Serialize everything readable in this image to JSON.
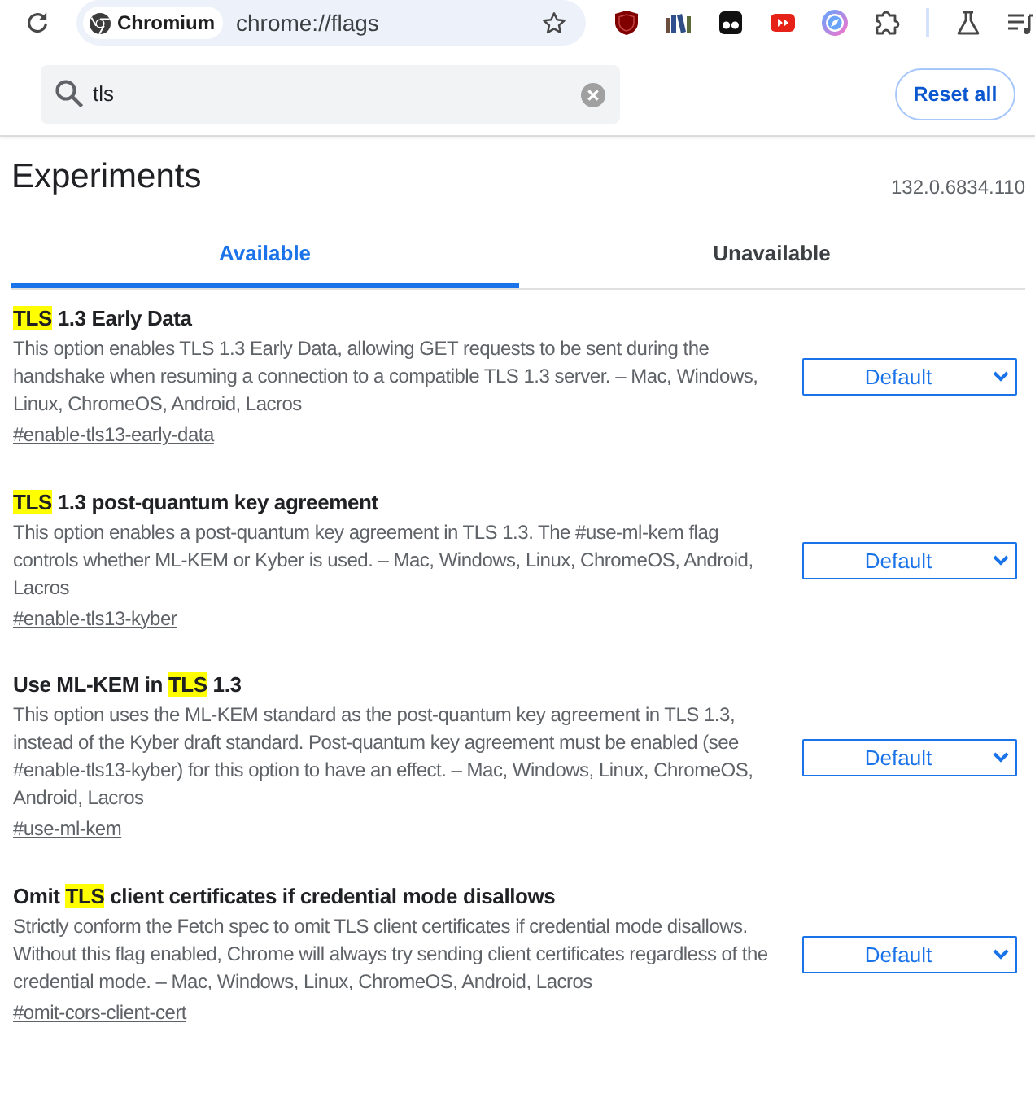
{
  "toolbar": {
    "site_chip": "Chromium",
    "url": "chrome://flags"
  },
  "search": {
    "value": "tls"
  },
  "reset_button": "Reset all",
  "header": {
    "title": "Experiments",
    "version": "132.0.6834.110"
  },
  "tabs": [
    {
      "label": "Available",
      "selected": true
    },
    {
      "label": "Unavailable",
      "selected": false
    }
  ],
  "flags": [
    {
      "title": [
        {
          "text": "TLS",
          "highlighted": true
        },
        {
          "text": " 1.3 Early Data",
          "highlighted": false
        }
      ],
      "description": "This option enables TLS 1.3 Early Data, allowing GET requests to be sent during the handshake when resuming a connection to a compatible TLS 1.3 server. – Mac, Windows, Linux, ChromeOS, Android, Lacros",
      "link": "#enable-tls13-early-data",
      "value": "Default"
    },
    {
      "title": [
        {
          "text": "TLS",
          "highlighted": true
        },
        {
          "text": " 1.3 post-quantum key agreement",
          "highlighted": false
        }
      ],
      "description": "This option enables a post-quantum key agreement in TLS 1.3. The #use-ml-kem flag controls whether ML-KEM or Kyber is used. – Mac, Windows, Linux, ChromeOS, Android, Lacros",
      "link": "#enable-tls13-kyber",
      "value": "Default"
    },
    {
      "title": [
        {
          "text": "Use ML-KEM in ",
          "highlighted": false
        },
        {
          "text": "TLS",
          "highlighted": true
        },
        {
          "text": " 1.3",
          "highlighted": false
        }
      ],
      "description": "This option uses the ML-KEM standard as the post-quantum key agreement in TLS 1.3, instead of the Kyber draft standard. Post-quantum key agreement must be enabled (see #enable-tls13-kyber) for this option to have an effect. – Mac, Windows, Linux, ChromeOS, Android, Lacros",
      "link": "#use-ml-kem",
      "value": "Default"
    },
    {
      "title": [
        {
          "text": "Omit ",
          "highlighted": false
        },
        {
          "text": "TLS",
          "highlighted": true
        },
        {
          "text": " client certificates if credential mode disallows",
          "highlighted": false
        }
      ],
      "description": "Strictly conform the Fetch spec to omit TLS client certificates if credential mode disallows. Without this flag enabled, Chrome will always try sending client certificates regardless of the credential mode. – Mac, Windows, Linux, ChromeOS, Android, Lacros",
      "link": "#omit-cors-client-cert",
      "value": "Default"
    }
  ]
}
